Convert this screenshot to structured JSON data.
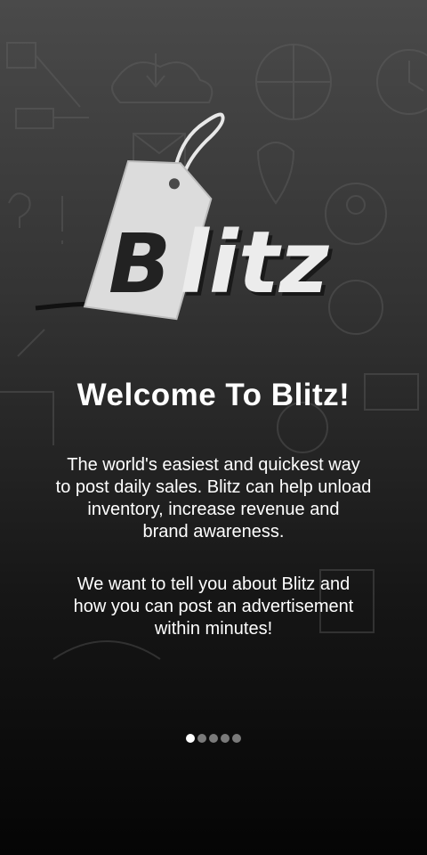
{
  "logo": {
    "text": "litz",
    "mark": "B"
  },
  "welcome": {
    "title": "Welcome To Blitz!",
    "paragraph1": "The world's  easiest and quickest way\nto post daily sales. Blitz can help unload\ninventory, increase revenue and\nbrand awareness.",
    "paragraph2": "We want  to tell you  about Blitz and\nhow you can post an advertisement\nwithin minutes!"
  },
  "pager": {
    "total": 5,
    "active_index": 0
  },
  "colors": {
    "text": "#ffffff",
    "dot_inactive": "#7a7a7a",
    "dot_active": "#ffffff"
  }
}
